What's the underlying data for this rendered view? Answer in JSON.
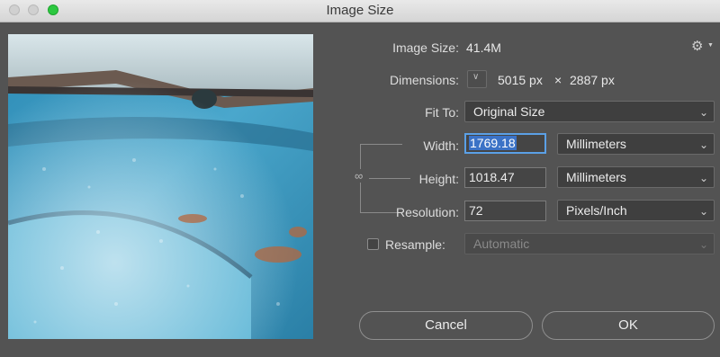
{
  "window": {
    "title": "Image Size"
  },
  "image_size": {
    "label": "Image Size:",
    "value": "41.4M"
  },
  "settings": {
    "icon": "gear-icon"
  },
  "dimensions": {
    "label": "Dimensions:",
    "width": "5015 px",
    "times": "×",
    "height": "2887 px"
  },
  "fit_to": {
    "label": "Fit To:",
    "value": "Original Size"
  },
  "width": {
    "label": "Width:",
    "value": "1769.18",
    "unit": "Millimeters"
  },
  "height": {
    "label": "Height:",
    "value": "1018.47",
    "unit": "Millimeters"
  },
  "resolution": {
    "label": "Resolution:",
    "value": "72",
    "unit": "Pixels/Inch"
  },
  "resample": {
    "label": "Resample:",
    "checked": false,
    "value": "Automatic"
  },
  "buttons": {
    "cancel": "Cancel",
    "ok": "OK"
  },
  "colors": {
    "accent": "#5ba0e6",
    "selection": "#3b72c6",
    "dialog_bg": "#535353"
  }
}
